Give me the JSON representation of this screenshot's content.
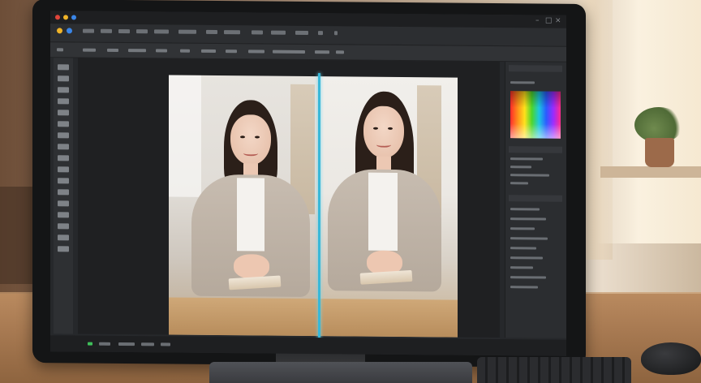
{
  "app": {
    "window_title": "",
    "menu_items": [],
    "options_items": []
  },
  "canvas": {
    "caption": "",
    "split_label": "",
    "before_label": "",
    "after_label": ""
  },
  "panels": {
    "color_panel_title": "",
    "properties_title": "",
    "layers_title": ""
  },
  "status": {
    "zoom": "",
    "info": ""
  },
  "colors": {
    "accent_split": "#39b8d8",
    "ui_dark": "#26282b",
    "panel_bg": "#2b2d30",
    "traffic_red": "#e0453a",
    "traffic_yellow": "#f0b428",
    "traffic_blue": "#3a86e8"
  }
}
